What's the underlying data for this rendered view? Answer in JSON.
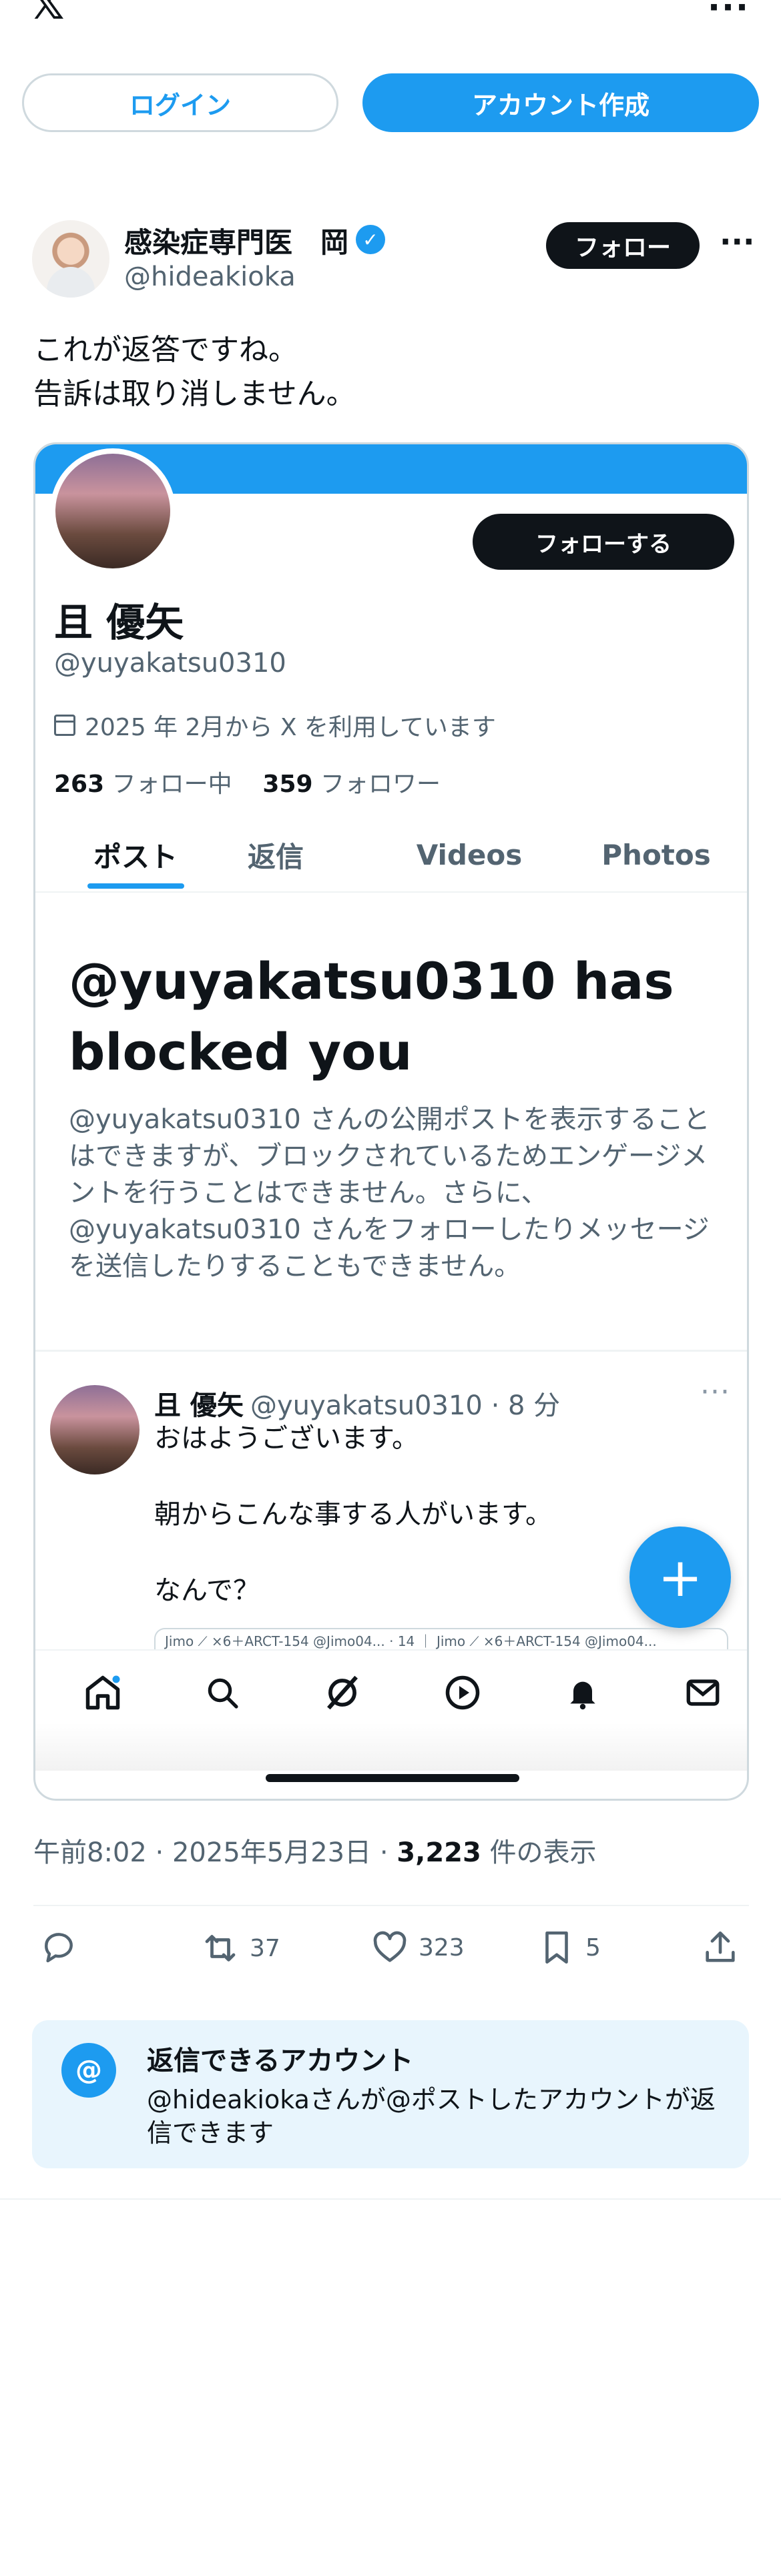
{
  "top": {
    "login_label": "ログイン",
    "signup_label": "アカウント作成"
  },
  "author": {
    "display_name": "感染症専門医　岡",
    "handle": "@hideakioka",
    "follow_label": "フォロー"
  },
  "tweet": {
    "lines": [
      "これが返答ですね。",
      "告訴は取り消しません。"
    ]
  },
  "embedded": {
    "profile": {
      "follow_label": "フォローする",
      "name": "且 優矢",
      "handle": "@yuyakatsu0310",
      "joined": "2025 年 2月から X を利用しています",
      "following_count": "263",
      "following_label": "フォロー中",
      "followers_count": "359",
      "followers_label": "フォロワー"
    },
    "tabs": [
      "ポスト",
      "返信",
      "Videos",
      "Photos"
    ],
    "blocked_title": "@yuyakatsu0310 has blocked you",
    "blocked_desc": "@yuyakatsu0310 さんの公開ポストを表示することはできますが、ブロックされているためエンゲージメントを行うことはできません。さらに、@yuyakatsu0310 さんをフォローしたりメッセージを送信したりすることもできません。",
    "post": {
      "name": "且 優矢",
      "handle_time": "@yuyakatsu0310 · 8 分",
      "text": "おはようございます。\n\n朝からこんな事する人がいます。\n\nなんで？"
    },
    "quote_preview": "Jimo ⟋ ×6＋ARCT-154 @Jimo04... · 14 ｜ Jimo ⟋ ×6＋ARCT-154 @Jimo04..."
  },
  "meta": {
    "time": "午前8:02",
    "date": "2025年5月23日",
    "views_count": "3,223",
    "views_label": "件の表示"
  },
  "actions": {
    "retweets": "37",
    "likes": "323",
    "bookmarks": "5"
  },
  "reply_settings": {
    "title": "返信できるアカウント",
    "desc": "@hideakiokaさんが@ポストしたアカウントが返信できます"
  },
  "icons": [
    "x-logo",
    "more-icon",
    "verified-icon",
    "calendar-icon",
    "home-icon",
    "search-icon",
    "grok-icon",
    "video-icon",
    "bell-icon",
    "mail-icon",
    "reply-icon",
    "retweet-icon",
    "like-icon",
    "bookmark-icon",
    "share-icon",
    "at-icon"
  ],
  "colors": {
    "accent": "#1d9bf0",
    "text": "#0f1419",
    "muted": "#536471",
    "reply_bg": "#e8f5fd"
  }
}
